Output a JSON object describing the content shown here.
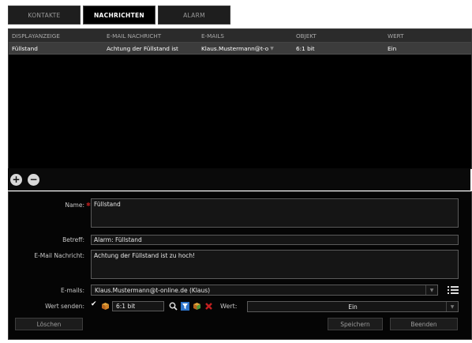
{
  "tabs": [
    "KONTAKTE",
    "NACHRICHTEN",
    "ALARM"
  ],
  "grid": {
    "columns": [
      "DISPLAYANZEIGE",
      "E-MAIL NACHRICHT",
      "E-MAILS",
      "OBJEKT",
      "WERT"
    ],
    "rows": [
      {
        "display": "Füllstand",
        "message": "Achtung der Füllstand ist",
        "emails": "Klaus.Mustermann@t-o",
        "object": "6:1 bit",
        "value": "Ein"
      }
    ]
  },
  "buttons": {
    "add": "+",
    "remove": "−",
    "delete": "Löschen",
    "save": "Speichern",
    "close": "Beenden"
  },
  "form": {
    "name_label": "Name:",
    "name_value": "Füllstand",
    "subject_label": "Betreff:",
    "subject_value": "Alarm: Füllstand",
    "message_label": "E-Mail Nachricht:",
    "message_value": "Achtung der Füllstand ist zu hoch!",
    "emails_label": "E-mails:",
    "emails_value": "Klaus.Mustermann@t-online.de (Klaus)",
    "send_label": "Wert senden:",
    "send_checked": true,
    "object_value": "6:1 bit",
    "value_label": "Wert:",
    "value_value": "Ein"
  }
}
